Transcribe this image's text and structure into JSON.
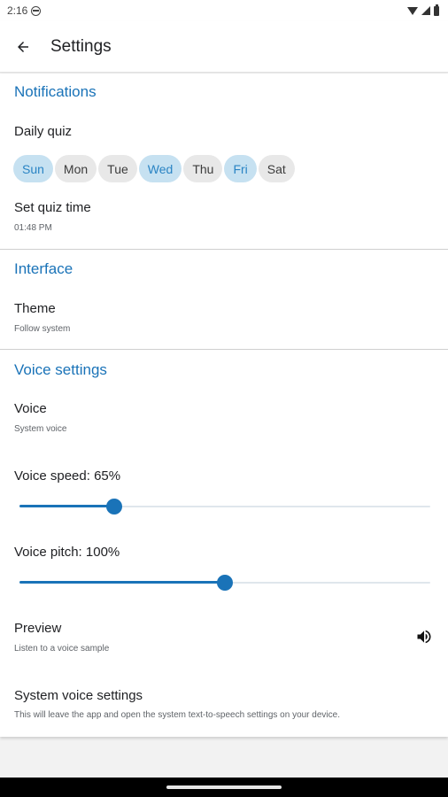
{
  "status_bar": {
    "time": "2:16"
  },
  "app_bar": {
    "title": "Settings"
  },
  "notifications": {
    "header": "Notifications",
    "daily_quiz_label": "Daily quiz",
    "days": [
      {
        "label": "Sun",
        "selected": true
      },
      {
        "label": "Mon",
        "selected": false
      },
      {
        "label": "Tue",
        "selected": false
      },
      {
        "label": "Wed",
        "selected": true
      },
      {
        "label": "Thu",
        "selected": false
      },
      {
        "label": "Fri",
        "selected": true
      },
      {
        "label": "Sat",
        "selected": false
      }
    ],
    "quiz_time_label": "Set quiz time",
    "quiz_time_value": "01:48 PM"
  },
  "interface": {
    "header": "Interface",
    "theme_label": "Theme",
    "theme_value": "Follow system"
  },
  "voice": {
    "header": "Voice settings",
    "voice_label": "Voice",
    "voice_value": "System voice",
    "speed_label": "Voice speed: 65%",
    "speed_fraction": 0.23,
    "pitch_label": "Voice pitch: 100%",
    "pitch_fraction": 0.5,
    "preview_label": "Preview",
    "preview_sub": "Listen to a voice sample",
    "system_settings_label": "System voice settings",
    "system_settings_sub": "This will leave the app and open the system text-to-speech settings on your device."
  },
  "colors": {
    "accent": "#1a73b8",
    "chip_selected_bg": "#c6e1f1",
    "chip_bg": "#e8e8e8"
  },
  "icons": {
    "back": "arrow-left",
    "preview": "speaker",
    "status": [
      "do-not-disturb",
      "wifi",
      "signal",
      "battery"
    ]
  }
}
